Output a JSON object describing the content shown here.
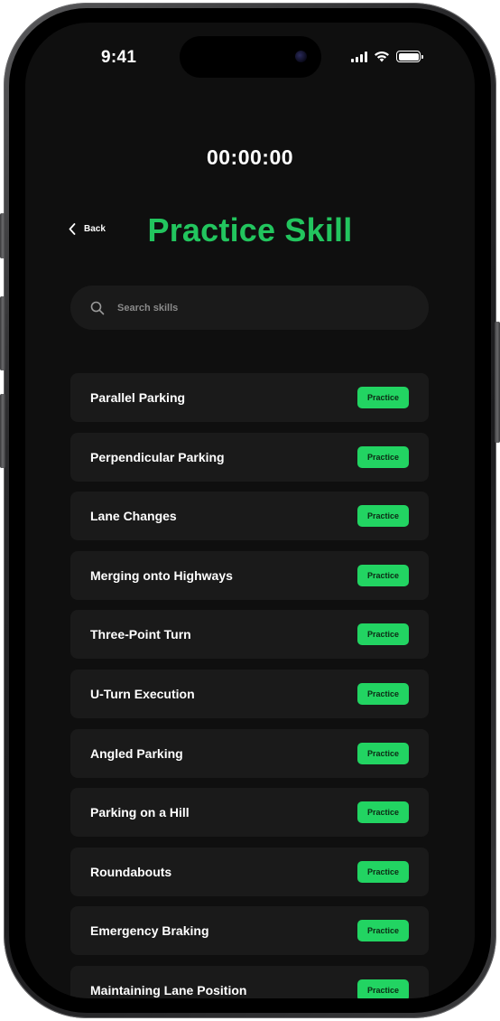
{
  "status_bar": {
    "time": "9:41",
    "icons": [
      "cellular-signal-icon",
      "wifi-icon",
      "battery-icon"
    ]
  },
  "timer": "00:00:00",
  "header": {
    "back_label": "Back",
    "title": "Practice Skill"
  },
  "search": {
    "placeholder": "Search skills",
    "value": ""
  },
  "skills": [
    {
      "name": "Parallel Parking",
      "action": "Practice"
    },
    {
      "name": "Perpendicular Parking",
      "action": "Practice"
    },
    {
      "name": "Lane Changes",
      "action": "Practice"
    },
    {
      "name": "Merging onto Highways",
      "action": "Practice"
    },
    {
      "name": "Three-Point Turn",
      "action": "Practice"
    },
    {
      "name": "U-Turn Execution",
      "action": "Practice"
    },
    {
      "name": "Angled Parking",
      "action": "Practice"
    },
    {
      "name": "Parking on a Hill",
      "action": "Practice"
    },
    {
      "name": "Roundabouts",
      "action": "Practice"
    },
    {
      "name": "Emergency Braking",
      "action": "Practice"
    },
    {
      "name": "Maintaining Lane Position",
      "action": "Practice"
    }
  ],
  "colors": {
    "accent": "#22c55e",
    "button": "#22d462",
    "background": "#0f0f0f",
    "card": "#1a1a1a"
  }
}
